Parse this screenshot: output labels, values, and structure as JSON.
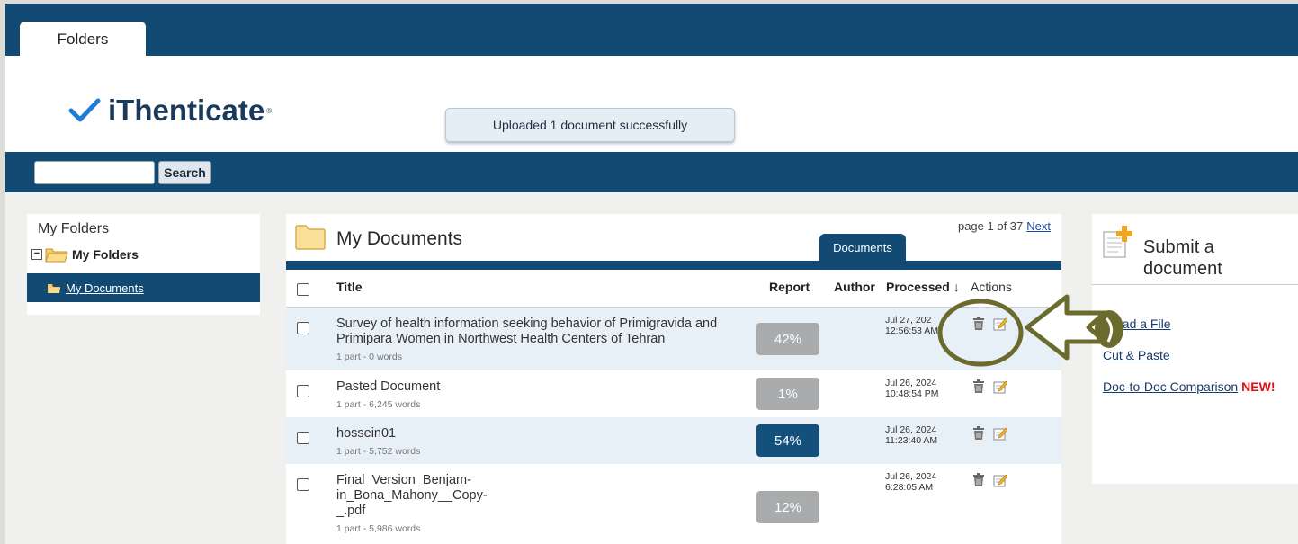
{
  "tab": {
    "label": "Folders"
  },
  "logo": {
    "text": "iThenticate",
    "mark": "®"
  },
  "toast": {
    "message": "Uploaded 1 document successfully"
  },
  "search": {
    "value": "",
    "button_label": "Search"
  },
  "sidebar": {
    "title": "My Folders",
    "tree_root": "My Folders",
    "selected_item": "My Documents"
  },
  "main": {
    "title": "My Documents",
    "tab_label": "Documents",
    "page_text": "page 1 of 37",
    "next_label": "Next",
    "columns": {
      "title": "Title",
      "report": "Report",
      "author": "Author",
      "processed": "Processed ↓",
      "actions": "Actions"
    },
    "rows": [
      {
        "title": "Survey of health information seeking behavior of Primigravida and Primipara Women in Northwest Health Centers of Tehran",
        "meta": "1 part - 0 words",
        "report": "42%",
        "report_color": "#a9abad",
        "date": "Jul 27, 202",
        "time": "12:56:53 AM"
      },
      {
        "title": "Pasted Document",
        "meta": "1 part - 6,245 words",
        "report": "1%",
        "report_color": "#a9abad",
        "date": "Jul 26, 2024",
        "time": "10:48:54 PM"
      },
      {
        "title": "hossein01",
        "meta": "1 part - 5,752 words",
        "report": "54%",
        "report_color": "#14507c",
        "date": "Jul 26, 2024",
        "time": "11:23:40 AM"
      },
      {
        "title": "Final_Version_Benjam-in_Bona_Mahony__Copy-_.pdf",
        "title_lines": [
          "Final_Version_Benjam-",
          "in_Bona_Mahony__Copy-",
          "_.pdf"
        ],
        "meta": "1 part - 5,986 words",
        "report": "12%",
        "report_color": "#a9abad",
        "date": "Jul 26, 2024",
        "time": "6:28:05 AM"
      }
    ]
  },
  "submit": {
    "title_line1": "Submit a",
    "title_line2": "document",
    "upload_label": "oad a File",
    "paste_label": "Cut & Paste",
    "compare_label": "Doc-to-Doc Comparison",
    "new_badge": "NEW!"
  },
  "colors": {
    "brand_dark": "#124a74",
    "check_blue": "#1f7dd6",
    "annotation": "#6b6b2e"
  }
}
